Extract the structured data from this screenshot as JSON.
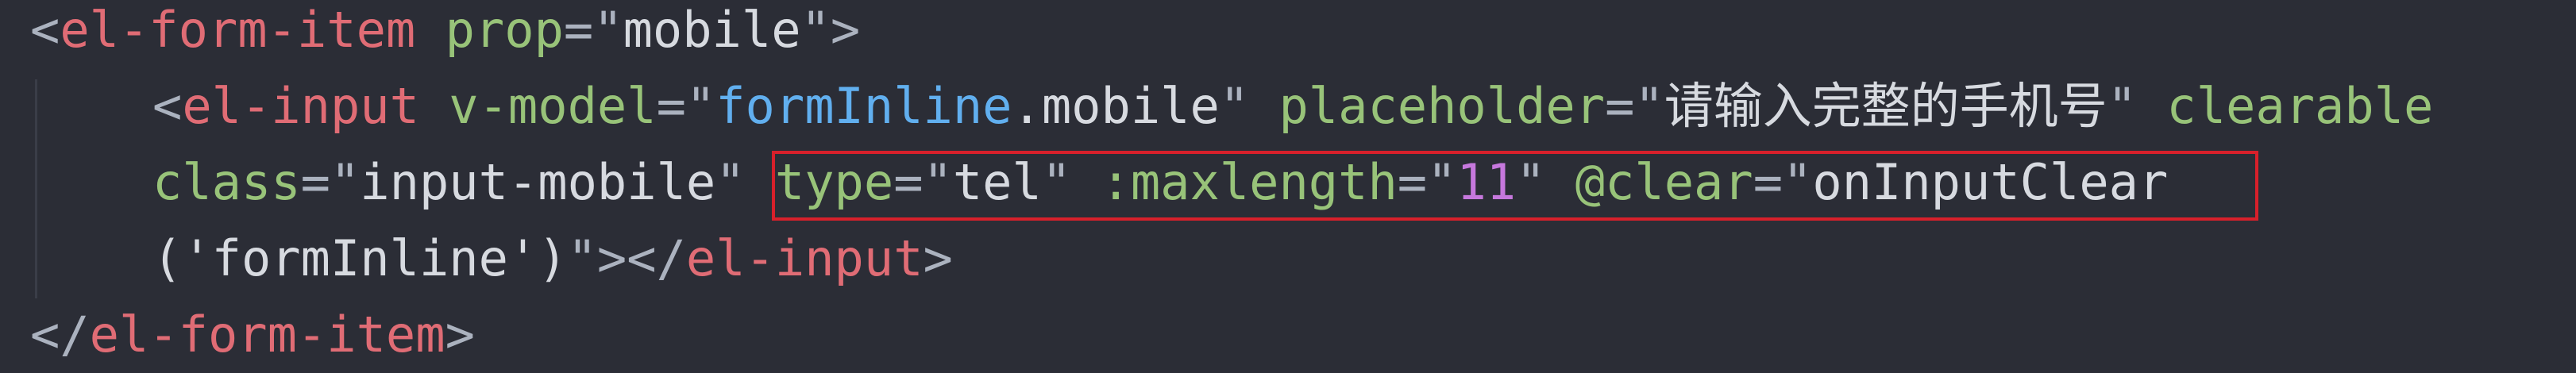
{
  "code": {
    "line1": {
      "open": "<",
      "tag": "el-form-item",
      "attr": " prop",
      "eq_quote": "=\"",
      "value": "mobile",
      "close": "\">"
    },
    "line2": {
      "open": "<",
      "tag": "el-input",
      "vmodel_attr": " v-model",
      "vmodel_eq": "=\"",
      "vmodel_obj": "formInline",
      "vmodel_prop": ".mobile",
      "vmodel_close": "\"",
      "placeholder_attr": " placeholder",
      "placeholder_eq": "=\"",
      "placeholder_value": "请输入完整的手机号",
      "placeholder_close": "\"",
      "clearable_attr": " clearable"
    },
    "line3": {
      "class_attr": "class",
      "class_eq": "=\"",
      "class_value": "input-mobile",
      "class_close": "\"",
      "type_attr": " type",
      "type_eq": "=\"",
      "type_value": "tel",
      "type_close": "\"",
      "maxlength_attr": " :maxlength",
      "maxlength_eq": "=\"",
      "maxlength_value": "11",
      "maxlength_close": "\"",
      "clear_attr": " @clear",
      "clear_eq": "=\"",
      "clear_value": "onInputClear"
    },
    "line4": {
      "args": "('formInline')",
      "close_quote": "\">",
      "end_open": "</",
      "tag": "el-input",
      "end_close": ">"
    },
    "line5": {
      "end_open": "</",
      "tag": "el-form-item",
      "end_close": ">"
    }
  },
  "colors": {
    "background": "#2b2d36",
    "tag": "#e06c75",
    "attribute": "#98c379",
    "string": "#d7dae0",
    "object": "#61afef",
    "number": "#c678dd",
    "highlight_border": "#d8202b"
  }
}
